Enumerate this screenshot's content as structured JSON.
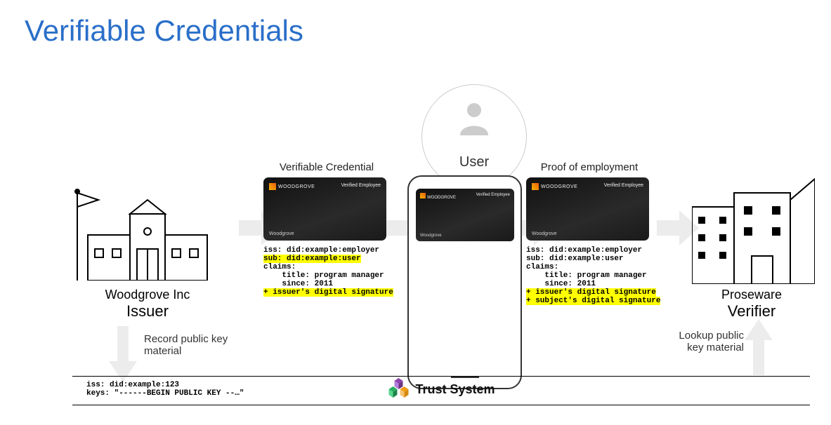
{
  "title": "Verifiable Credentials",
  "issuer": {
    "name": "Woodgrove Inc",
    "role": "Issuer"
  },
  "verifier": {
    "name": "Proseware",
    "role": "Verifier"
  },
  "user": {
    "label": "User"
  },
  "rec_label": "Record public key material",
  "lookup_label": "Lookup public key material",
  "vc": {
    "title": "Verifiable Credential",
    "iss": "iss: did:example:employer",
    "sub": "sub: did:example:user",
    "claims_hdr": "claims:",
    "claim_title": "    title: program manager",
    "claim_since": "    since: 2011",
    "sig_issuer": "+ issuer's digital signature"
  },
  "proof": {
    "title": "Proof of employment",
    "iss": "iss: did:example:employer",
    "sub": "sub: did:example:user",
    "claims_hdr": "claims:",
    "claim_title": "    title: program manager",
    "claim_since": "    since: 2011",
    "sig_issuer": "+ issuer's digital signature",
    "sig_subject": "+ subject's digital signature"
  },
  "card": {
    "brand": "WOODGROVE",
    "label": "Verified Employee",
    "company": "Woodgrove"
  },
  "trust": {
    "name": "Trust System",
    "iss": "iss: did:example:123",
    "keys": "keys: \"------BEGIN PUBLIC KEY --…\""
  }
}
